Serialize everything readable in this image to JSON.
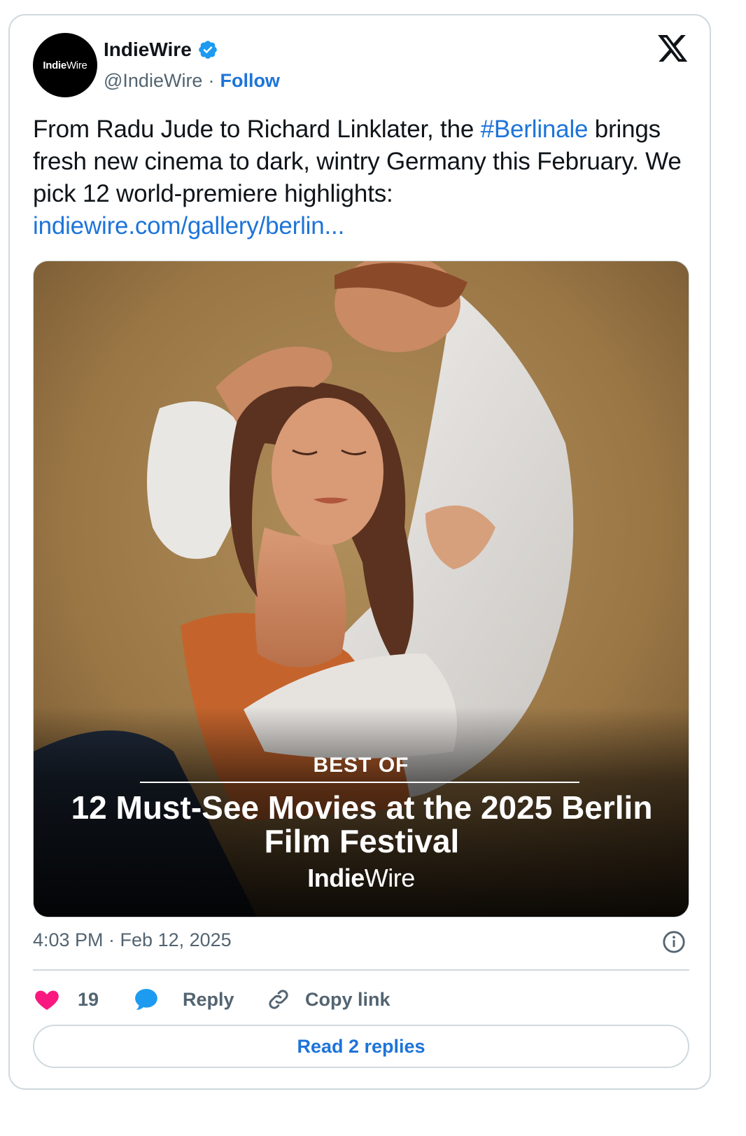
{
  "author": {
    "avatar_text_bold": "Indie",
    "avatar_text_light": "Wire",
    "display_name": "IndieWire",
    "handle": "@IndieWire",
    "separator": "·",
    "follow_label": "Follow"
  },
  "tweet": {
    "text_part1": "From Radu Jude to Richard Linklater, the ",
    "hashtag": "#Berlinale",
    "text_part2": " brings fresh new cinema to dark, wintry Germany this February. We pick 12 world-premiere highlights:",
    "link": "indiewire.com/gallery/berlin..."
  },
  "media": {
    "kicker": "BEST OF",
    "headline": "12 Must-See Movies at the 2025 Berlin Film Festival",
    "brand_bold": "Indie",
    "brand_light": "Wire"
  },
  "meta": {
    "timestamp": "4:03 PM · Feb 12, 2025"
  },
  "actions": {
    "likes": "19",
    "reply_label": "Reply",
    "copy_label": "Copy link"
  },
  "read_replies_label": "Read 2 replies",
  "colors": {
    "accent": "#1d74d9",
    "like": "#f91880",
    "reply_icon": "#1d9bf0",
    "muted": "#536471",
    "border": "#cfd9de"
  }
}
